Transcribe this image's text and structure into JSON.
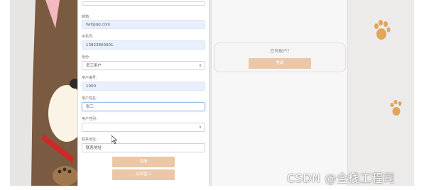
{
  "form": {
    "top_field_value": "",
    "email": {
      "label": "邮箱:",
      "value": "fwf@qq.com"
    },
    "phone": {
      "label": "手机号:",
      "value": "13823800001"
    },
    "identity": {
      "label": "身份:",
      "value": "员工用户"
    },
    "account_number": {
      "label": "用户编号:",
      "value": "1000"
    },
    "name": {
      "label": "用户姓名:",
      "value": "张三"
    },
    "gender": {
      "label": "用户性别:",
      "value": ""
    },
    "address": {
      "label": "联系地址:",
      "placeholder": "联系地址"
    },
    "register_label": "注册",
    "close_label": "关闭窗口"
  },
  "account": {
    "prompt": "已有账户?",
    "login_label": "登录"
  },
  "watermark": "CSDN @全栈工程司",
  "colors": {
    "button": "#ebc7a7",
    "paw": "#e2a55a",
    "field_highlight": "#e8f0fe"
  }
}
